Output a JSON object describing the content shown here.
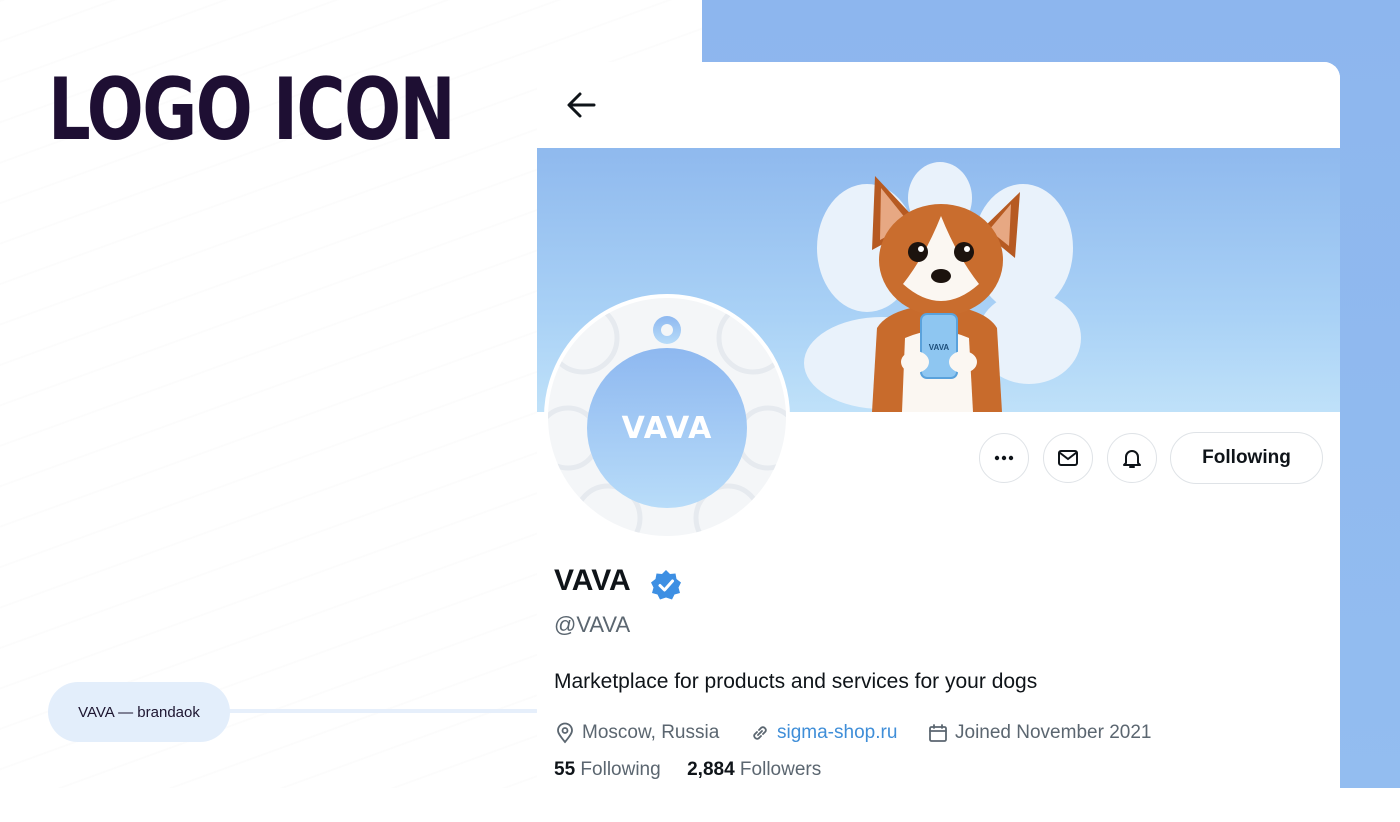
{
  "slide": {
    "title": "LOGO ICON",
    "caption": "VAVA — brandaok"
  },
  "colors": {
    "title": "#1e0f33",
    "background_accent": "#8db6ee",
    "link": "#3f8ed8",
    "verified": "#3d8fe3"
  },
  "profile": {
    "back_icon": "arrow-left-icon",
    "logo_text": "VAVA",
    "mascot_phone_text": "VAVA",
    "actions": {
      "more_icon": "more-horizontal-icon",
      "message_icon": "envelope-icon",
      "notify_icon": "bell-icon",
      "follow_label": "Following"
    },
    "display_name": "VAVA",
    "verified_icon": "verified-badge-icon",
    "handle": "@VAVA",
    "bio": "Marketplace for products and services for your dogs",
    "location": "Moscow, Russia",
    "website": "sigma-shop.ru",
    "joined": "Joined November 2021",
    "following_count": "55",
    "following_label": "Following",
    "followers_count": "2,884",
    "followers_label": "Followers"
  }
}
